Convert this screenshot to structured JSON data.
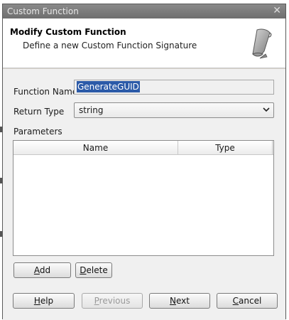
{
  "window": {
    "title": "Custom Function",
    "close_glyph": "✕"
  },
  "header": {
    "title": "Modify Custom Function",
    "subtitle": "Define a new Custom Function Signature",
    "icon": "scroll-icon"
  },
  "form": {
    "function_name_label": "Function Name",
    "function_name_value": "GenerateGUID",
    "return_type_label": "Return Type",
    "return_type_value": "string",
    "parameters_label": "Parameters"
  },
  "parameters_table": {
    "columns": [
      "Name",
      "Type"
    ],
    "rows": []
  },
  "buttons": {
    "add": {
      "mnemonic": "A",
      "rest": "dd"
    },
    "delete": {
      "mnemonic": "D",
      "rest": "elete"
    },
    "help": {
      "mnemonic": "H",
      "rest": "elp"
    },
    "previous": {
      "mnemonic": "P",
      "rest": "revious"
    },
    "next": {
      "mnemonic": "N",
      "rest": "ext"
    },
    "cancel": {
      "mnemonic": "C",
      "rest": "ancel"
    }
  },
  "colors": {
    "titlebar": "#7a7a7a",
    "selection": "#2b5aa8",
    "dialog_bg": "#f0f0f0"
  }
}
